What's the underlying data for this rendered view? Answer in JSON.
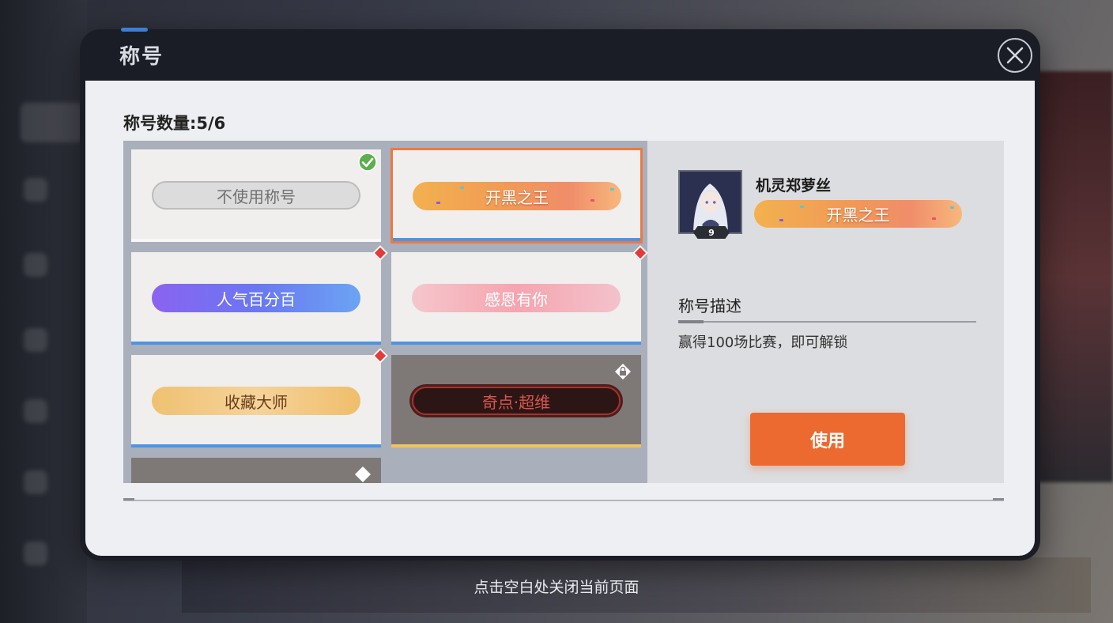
{
  "modal": {
    "title": "称号",
    "count_label": "称号数量:5/6"
  },
  "titles": [
    {
      "label": "不使用称号",
      "state": "equipped-check"
    },
    {
      "label": "开黑之王",
      "state": "selected"
    },
    {
      "label": "人气百分百",
      "state": "new"
    },
    {
      "label": "感恩有你",
      "state": "new"
    },
    {
      "label": "收藏大师",
      "state": "new"
    },
    {
      "label": "奇点·超维",
      "state": "locked"
    }
  ],
  "detail": {
    "avatar_level": "9",
    "player_name": "机灵郑萝丝",
    "title_label": "开黑之王",
    "desc_heading": "称号描述",
    "desc_text": "赢得100场比赛，即可解锁",
    "use_button": "使用"
  },
  "footer": {
    "hint": "点击空白处关闭当前页面"
  },
  "colors": {
    "accent": "#ec6a2f",
    "underline_blue": "#4b94e8",
    "underline_gold": "#f2c358",
    "new_dot": "#e23b3b",
    "check_green": "#4caf50"
  },
  "icons": [
    "close-icon",
    "check-icon",
    "lock-icon",
    "new-dot-icon"
  ]
}
